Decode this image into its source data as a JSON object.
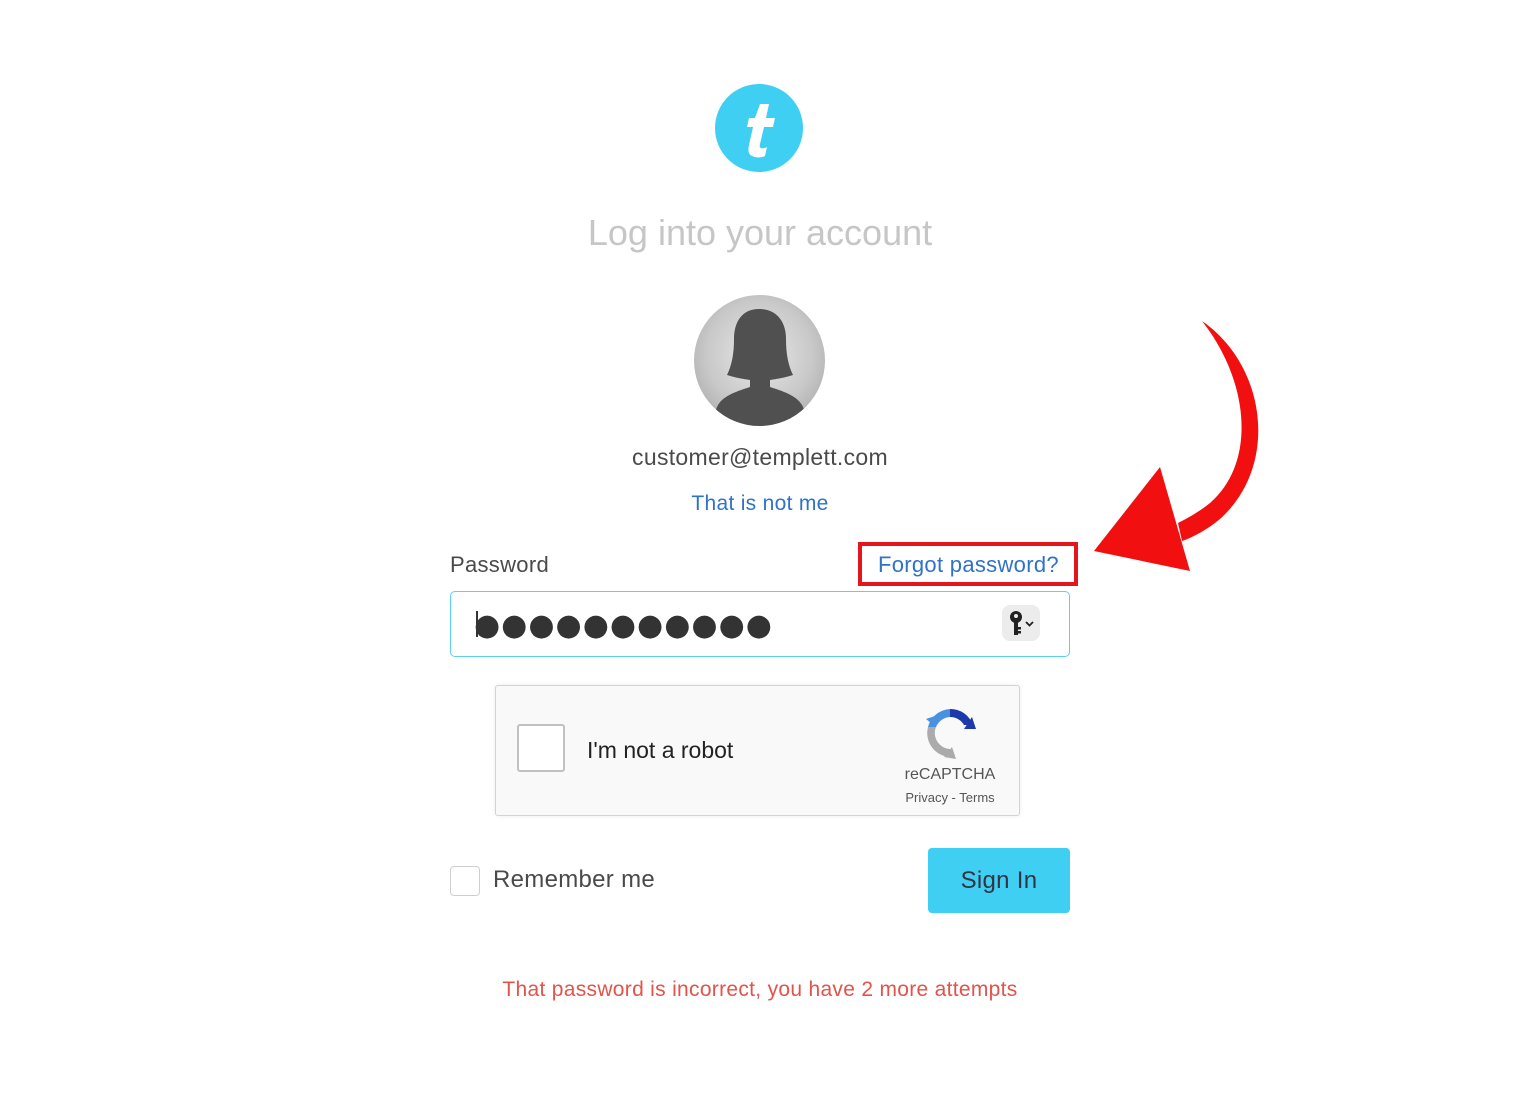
{
  "page": {
    "title": "Log into your account"
  },
  "account": {
    "email": "customer@templett.com",
    "not_me_link": "That is not me"
  },
  "password": {
    "label": "Password",
    "forgot_link": "Forgot password?",
    "masked_value": "●●●●●●●●●●●"
  },
  "captcha": {
    "label": "I'm not a robot",
    "brand": "reCAPTCHA",
    "links": "Privacy - Terms"
  },
  "remember": {
    "label": "Remember me"
  },
  "actions": {
    "sign_in": "Sign In"
  },
  "error": {
    "message": "That password is incorrect, you have 2 more attempts"
  },
  "colors": {
    "brand": "#3ecff3",
    "link": "#2f73c8",
    "error": "#e2534a",
    "highlight": "#e5161b"
  },
  "icons": {
    "logo": "templett-t-logo",
    "avatar": "user-silhouette",
    "key": "key-icon",
    "captcha": "recaptcha-logo",
    "annotation": "red-curved-arrow"
  }
}
